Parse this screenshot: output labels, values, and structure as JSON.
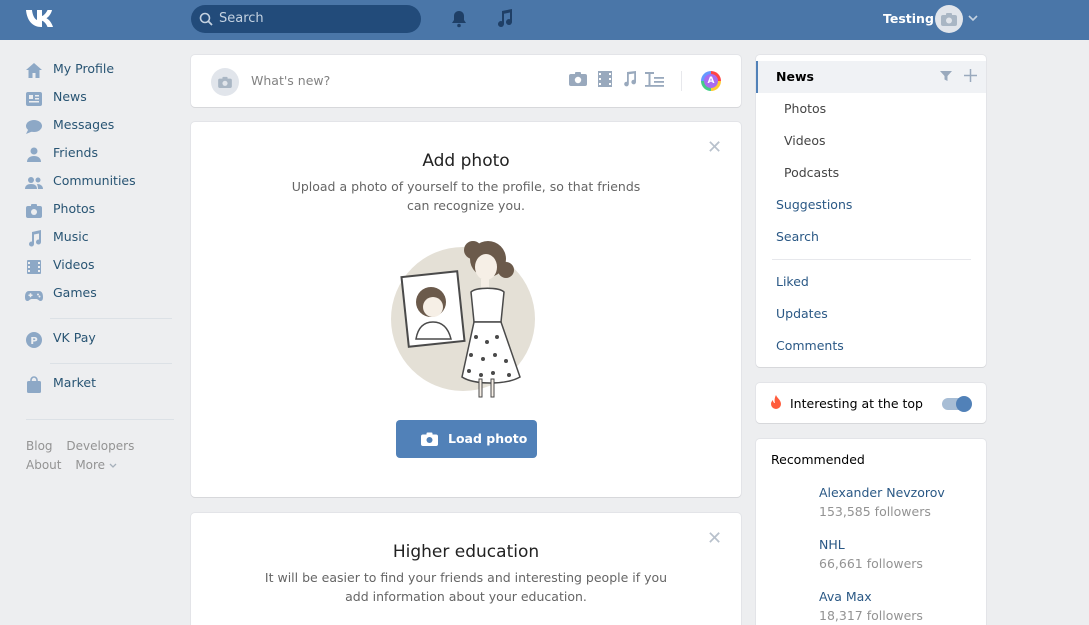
{
  "topbar": {
    "search_placeholder": "Search",
    "username": "Testing",
    "icons": [
      "vk-logo-icon",
      "search-icon",
      "bell-icon",
      "music-note-icon",
      "camera-icon",
      "chevron-down-icon"
    ]
  },
  "leftnav": {
    "items": [
      {
        "label": "My Profile",
        "icon": "home-icon"
      },
      {
        "label": "News",
        "icon": "news-icon"
      },
      {
        "label": "Messages",
        "icon": "messages-icon"
      },
      {
        "label": "Friends",
        "icon": "friends-icon"
      },
      {
        "label": "Communities",
        "icon": "communities-icon"
      },
      {
        "label": "Photos",
        "icon": "camera-icon"
      },
      {
        "label": "Music",
        "icon": "music-icon"
      },
      {
        "label": "Videos",
        "icon": "film-icon"
      },
      {
        "label": "Games",
        "icon": "gamepad-icon"
      }
    ],
    "vkpay": "VK Pay",
    "market": "Market",
    "footer": {
      "blog": "Blog",
      "developers": "Developers",
      "about": "About",
      "more": "More"
    }
  },
  "post_box": {
    "placeholder": "What's new?"
  },
  "photo_card": {
    "title": "Add photo",
    "description": "Upload a photo of yourself to the profile, so that friends can recognize you.",
    "button": "Load photo"
  },
  "edu_card": {
    "title": "Higher education",
    "description": "It will be easier to find your friends and interesting people if you add information about your education."
  },
  "right_menu": {
    "active": "News",
    "sub_items": [
      "Photos",
      "Videos",
      "Podcasts"
    ],
    "items": [
      "Suggestions",
      "Search"
    ],
    "items2": [
      "Liked",
      "Updates",
      "Comments"
    ]
  },
  "toggle": {
    "label": "Interesting at the top",
    "on": true
  },
  "recommended": {
    "title": "Recommended",
    "items": [
      {
        "name": "Alexander Nevzorov",
        "followers": "153,585 followers"
      },
      {
        "name": "NHL",
        "followers": "66,661 followers"
      },
      {
        "name": "Ava Max",
        "followers": "18,317 followers"
      }
    ]
  },
  "colors": {
    "brand": "#4a76a8",
    "link": "#2a5885",
    "button": "#5181b8",
    "background": "#edeef0"
  }
}
